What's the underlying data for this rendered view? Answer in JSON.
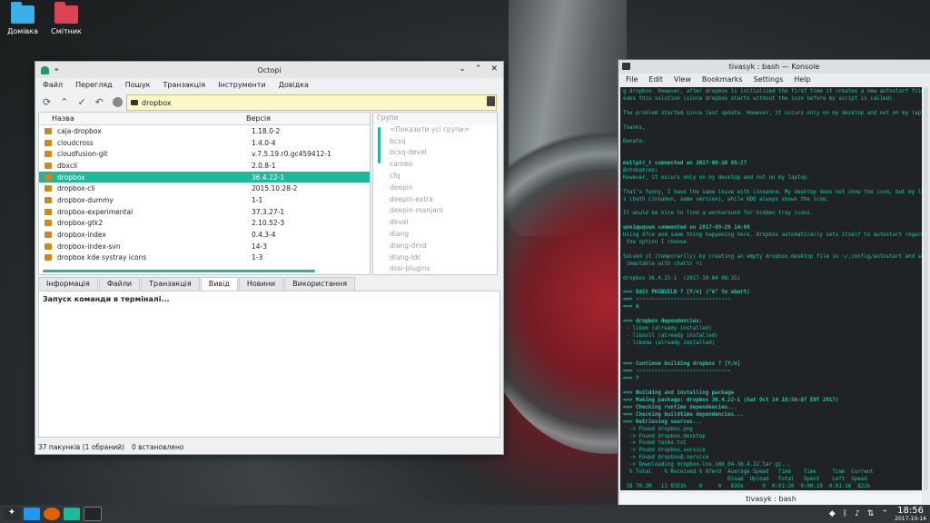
{
  "desktop": {
    "icons": [
      {
        "label": "Домівка",
        "color": "#3daee9"
      },
      {
        "label": "Смітник",
        "color": "#da4453"
      }
    ]
  },
  "octopi": {
    "title": "Octopi",
    "menu": [
      "Файл",
      "Перегляд",
      "Пошук",
      "Транзакція",
      "Інструменти",
      "Довідка"
    ],
    "search_value": "dropbox",
    "columns": {
      "name": "Назва",
      "version": "Версія"
    },
    "packages": [
      {
        "name": "caja-dropbox",
        "version": "1.18.0-2",
        "selected": false
      },
      {
        "name": "cloudcross",
        "version": "1.4.0-4",
        "selected": false
      },
      {
        "name": "cloudfusion-git",
        "version": "v.7.5.19.r0.gc459412-1",
        "selected": false
      },
      {
        "name": "dbxcli",
        "version": "2.0.8-1",
        "selected": false
      },
      {
        "name": "dropbox",
        "version": "36.4.22-1",
        "selected": true
      },
      {
        "name": "dropbox-cli",
        "version": "2015.10.28-2",
        "selected": false
      },
      {
        "name": "dropbox-dummy",
        "version": "1-1",
        "selected": false
      },
      {
        "name": "dropbox-experimental",
        "version": "37.3.27-1",
        "selected": false
      },
      {
        "name": "dropbox-gtk2",
        "version": "2.10.52-3",
        "selected": false
      },
      {
        "name": "dropbox-index",
        "version": "0.4.3-4",
        "selected": false
      },
      {
        "name": "dropbox-index-svn",
        "version": "14-3",
        "selected": false
      },
      {
        "name": "dropbox kde systray icons",
        "version": "1-3",
        "selected": false
      }
    ],
    "groups_header": "Групи",
    "groups": [
      "<Показати усі групи>",
      "bcsq",
      "bcsq-devel",
      "cameo",
      "cfq",
      "deepin",
      "deepin-extra",
      "deepin-manjaro",
      "devel",
      "dlang",
      "dlang-dmd",
      "dlang-ldc",
      "dssi-plugins"
    ],
    "tabs": [
      "Інформація",
      "Файли",
      "Транзакція",
      "Вивід",
      "Новини",
      "Використання"
    ],
    "active_tab": "Вивід",
    "output_text": "Запуск команди в терміналі...",
    "status_packages": "37 пакунків (1 обраний)",
    "status_installed": "0 встановлено"
  },
  "konsole": {
    "title": "tivasyk : bash — Konsole",
    "menu": [
      "File",
      "Edit",
      "View",
      "Bookmarks",
      "Settings",
      "Help"
    ],
    "tab_label": "tivasyk : bash",
    "lines": [
      "g dropbox. However, after dropbox is initialized the first time it creates a new autostart file which b",
      "eaks this solution (since dropbox starts without the icon before my script is called).",
      "",
      "The problem started since last update. However, it occurs only on my desktop and not on my laptop.",
      "",
      "Thanks,",
      "",
      "Donato.",
      "",
      "",
      "mullptr_t commented on 2017-09-28 05:27",
      "@chohatcon:",
      "However, it occurs only on my desktop and not on my laptop.",
      "",
      "That's funny, I have the same issue with cinnamon. My desktop does not show the icon, but my laptop doe",
      "s (both cinnamon, same version), while KDE always shows the icon.",
      "",
      "It would be nice to find a workaround for hidden tray icons.",
      "",
      "unniququum commented on 2017-09-29 14:09",
      "Using Xfce and same thing happening here. Dropbox automatically sets itself to autostart regardless of",
      " the option I choose.",
      "",
      "Solved it (temporarily) by creating an empty dropbox.desktop file in ~/.config/autostart and setting it",
      " immutable with chattr +i",
      "",
      "dropbox 36.4.22-1  (2017-10-04 08:31)",
      "",
      "==> Edit PKGBUILD ? [Y/n] (\"A\" to abort)",
      "==> ------------------------------",
      "==> n",
      "",
      "==> dropbox dependencies:",
      " - libxm (already installed)",
      " - libxslt (already installed)",
      " - libxmu (already installed)",
      "",
      "",
      "==> Continue building dropbox ? [Y/n]",
      "==> ------------------------------",
      "==> ?",
      "",
      "==> Building and installing package",
      "==> Making package: dropbox 36.4.22-1 (Sat Oct 14 18:56:07 EDT 2017)",
      "==> Checking runtime dependencies...",
      "==> Checking buildtime dependencies...",
      "==> Retrieving sources...",
      "  -> Found dropbox.png",
      "  -> Found dropbox.desktop",
      "  -> Found terms.txt",
      "  -> Found dropbox.service",
      "  -> Found dropbox@.service",
      "  -> Downloading dropbox-lnx.x86_64-36.4.22.tar.gz...",
      "  % Total    % Received % Xferd  Average Speed   Time    Time     Time  Current",
      "                                 Dload  Upload   Total   Spent    Left  Speed",
      " 38 70.2M   11 8353k    0     0   835k      0  0:01:26  0:00:10  0:01:16  822k"
    ]
  },
  "taskbar": {
    "time": "18:56",
    "date": "2017-10-14"
  }
}
